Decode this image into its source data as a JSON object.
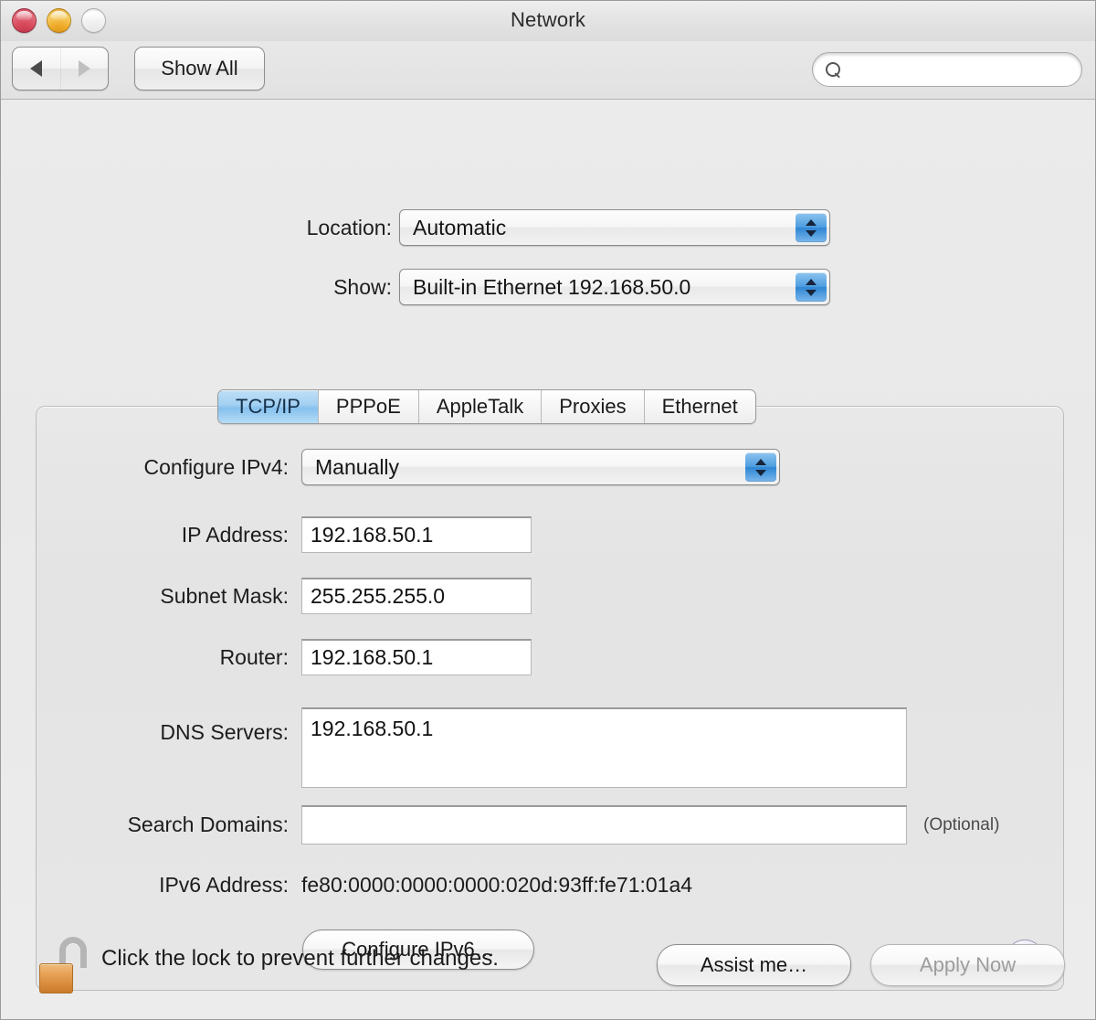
{
  "window": {
    "title": "Network",
    "controls": {
      "close": "close-button",
      "minimize": "minimize-button",
      "zoom": "zoom-button"
    }
  },
  "toolbar": {
    "back_label": "◀",
    "forward_label": "▶",
    "show_all_label": "Show All",
    "search_placeholder": "",
    "search_value": ""
  },
  "top_form": {
    "location_label": "Location:",
    "location_value": "Automatic",
    "show_label": "Show:",
    "show_value": "Built-in Ethernet 192.168.50.0"
  },
  "tabs": [
    {
      "label": "TCP/IP",
      "active": true
    },
    {
      "label": "PPPoE",
      "active": false
    },
    {
      "label": "AppleTalk",
      "active": false
    },
    {
      "label": "Proxies",
      "active": false
    },
    {
      "label": "Ethernet",
      "active": false
    }
  ],
  "tcpip": {
    "configure_ipv4_label": "Configure IPv4:",
    "configure_ipv4_value": "Manually",
    "ip_address_label": "IP Address:",
    "ip_address_value": "192.168.50.1",
    "subnet_mask_label": "Subnet Mask:",
    "subnet_mask_value": "255.255.255.0",
    "router_label": "Router:",
    "router_value": "192.168.50.1",
    "dns_servers_label": "DNS Servers:",
    "dns_servers_value": "192.168.50.1",
    "search_domains_label": "Search Domains:",
    "search_domains_value": "",
    "search_domains_hint": "(Optional)",
    "ipv6_address_label": "IPv6 Address:",
    "ipv6_address_value": "fe80:0000:0000:0000:020d:93ff:fe71:01a4",
    "configure_ipv6_label": "Configure IPv6…",
    "help_label": "?"
  },
  "bottom": {
    "lock_icon": "unlocked-padlock-icon",
    "lock_text": "Click the lock to prevent further changes.",
    "assist_label": "Assist me…",
    "apply_label": "Apply Now",
    "apply_enabled": false
  },
  "colors": {
    "accent_blue": "#4e9ee0",
    "active_tab": "#a2cff2",
    "window_bg": "#ececec",
    "panel_bg": "#e6e6e6",
    "lock_orange": "#e8a156",
    "help_lavender": "#d7d3ea",
    "close_red": "#d94a5c",
    "min_yellow": "#f0ae2c"
  }
}
